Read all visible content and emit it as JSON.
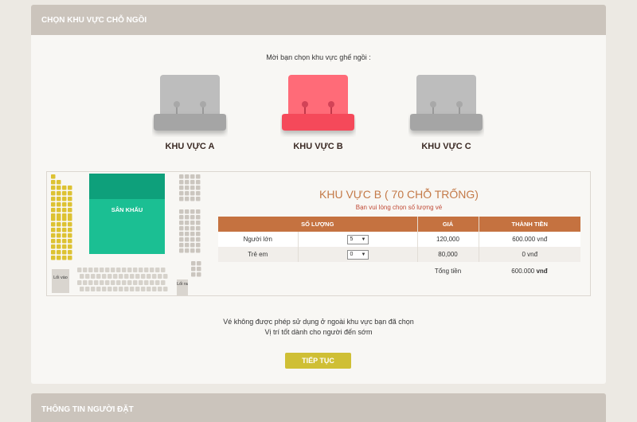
{
  "section1": {
    "title": "CHỌN KHU VỰC CHỖ NGỒI",
    "prompt": "Mời bạn chọn khu vực ghế ngồi :"
  },
  "zones": [
    {
      "label": "KHU VỰC A",
      "selected": false,
      "color": "#bdbdbd"
    },
    {
      "label": "KHU VỰC B",
      "selected": true,
      "color": "#ff5b6a"
    },
    {
      "label": "KHU VỰC C",
      "selected": false,
      "color": "#bdbdbd"
    }
  ],
  "seatmap": {
    "stage_label": "SÂN KHẤU",
    "exit_in": "Lối vào",
    "exit_out": "Lối ra"
  },
  "selected_zone": {
    "title": "KHU VỰC B ( 70 CHỖ TRỐNG)",
    "subtitle": "Bạn vui lòng chọn số lượng vé"
  },
  "table": {
    "headers": [
      "SỐ LƯỢNG",
      "GIÁ",
      "THÀNH TIỀN"
    ],
    "rows": [
      {
        "type": "Người lớn",
        "qty": "5",
        "price": "120,000",
        "total": "600.000 vnđ"
      },
      {
        "type": "Trẻ em",
        "qty": "0",
        "price": "80,000",
        "total": "0 vnđ"
      }
    ],
    "total_label": "Tổng tiền",
    "total_value": "600.000",
    "total_unit": "vnđ"
  },
  "notes": [
    "Vé không được phép sử dụng ở ngoài khu vực bạn đã chọn",
    "Vị trí tốt dành cho người đến sớm"
  ],
  "continue_label": "TIẾP TỤC",
  "section2": {
    "title": "THÔNG TIN NGƯỜI ĐẶT"
  },
  "colors": {
    "accent": "#c57240",
    "stage": "#1bbf93",
    "button": "#cfbf35",
    "selected_zone": "#ff5b6a",
    "header": "#cbc4bc"
  }
}
